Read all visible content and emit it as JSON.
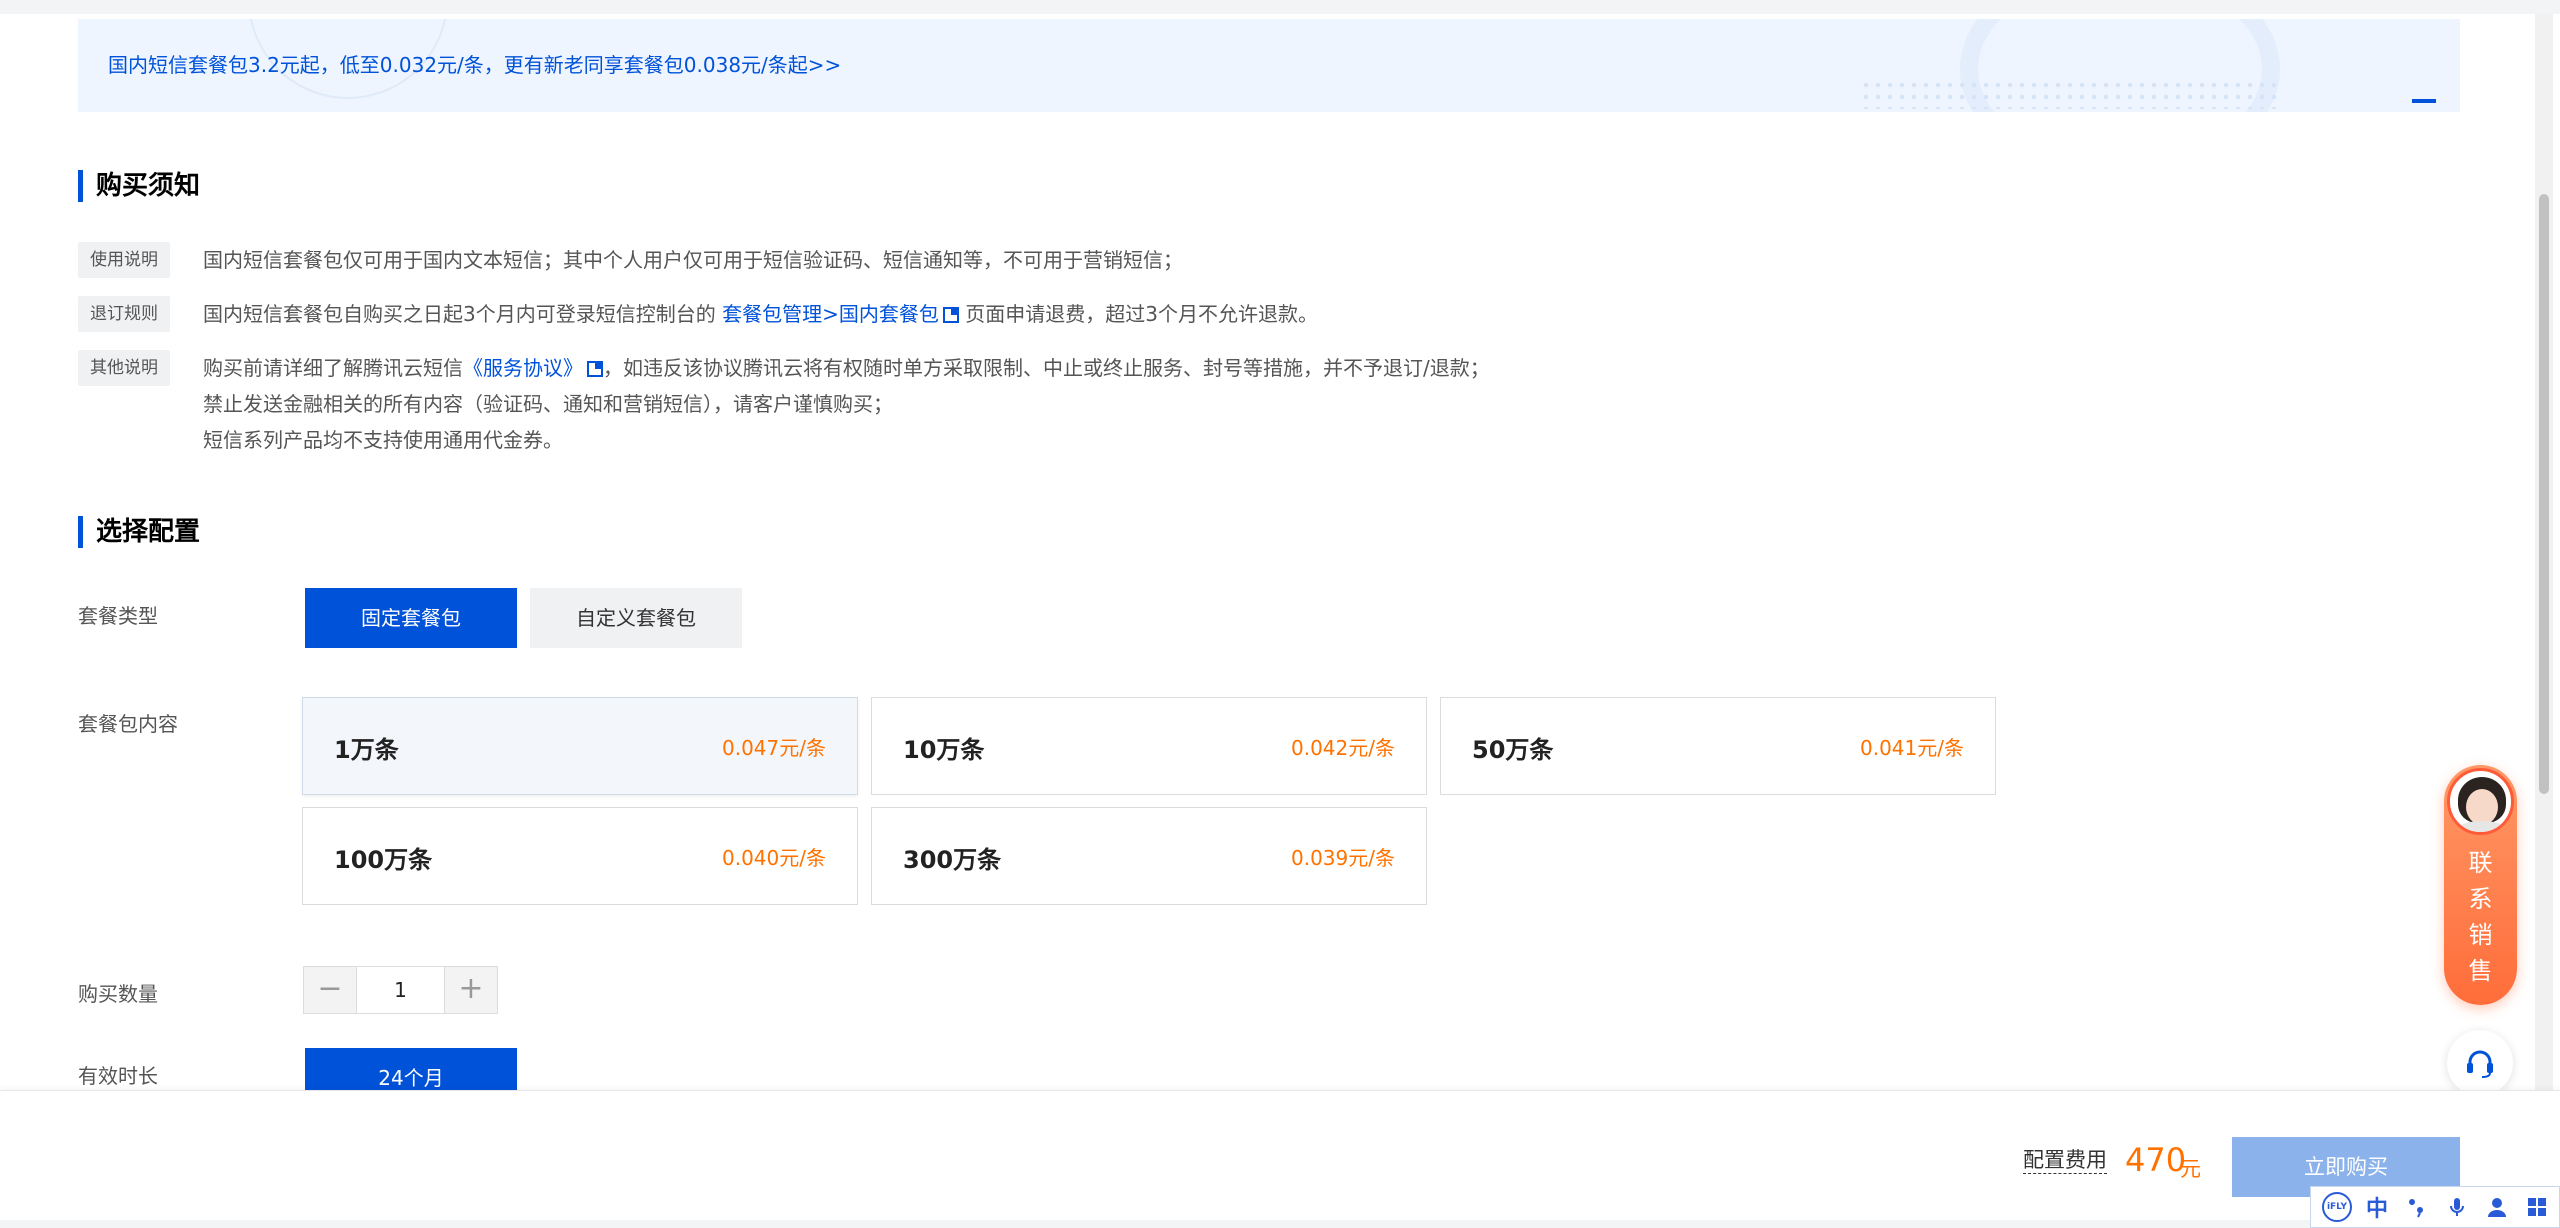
{
  "banner": {
    "text": "国内短信套餐包3.2元起，低至0.032元/条，更有新老同享套餐包0.038元/条起>>"
  },
  "notice": {
    "title": "购买须知",
    "usage": {
      "tag": "使用说明",
      "text": "国内短信套餐包仅可用于国内文本短信；其中个人用户仅可用于短信验证码、短信通知等，不可用于营销短信；"
    },
    "refund": {
      "tag": "退订规则",
      "before": "国内短信套餐包自购买之日起3个月内可登录短信控制台的",
      "link": "套餐包管理>国内套餐包",
      "after": "页面申请退费，超过3个月不允许退款。"
    },
    "other": {
      "tag": "其他说明",
      "line1_before": "购买前请详细了解腾讯云短信",
      "line1_link": "《服务协议》",
      "line1_after": "，如违反该协议腾讯云将有权随时单方采取限制、中止或终止服务、封号等措施，并不予退订/退款；",
      "line2": "禁止发送金融相关的所有内容（验证码、通知和营销短信），请客户谨慎购买；",
      "line3": "短信系列产品均不支持使用通用代金券。"
    }
  },
  "config": {
    "title": "选择配置",
    "type_label": "套餐类型",
    "types": [
      "固定套餐包",
      "自定义套餐包"
    ],
    "content_label": "套餐包内容",
    "packages": [
      {
        "name": "1万条",
        "price": "0.047元/条",
        "selected": true
      },
      {
        "name": "10万条",
        "price": "0.042元/条"
      },
      {
        "name": "50万条",
        "price": "0.041元/条"
      },
      {
        "name": "100万条",
        "price": "0.040元/条"
      },
      {
        "name": "300万条",
        "price": "0.039元/条"
      }
    ],
    "quantity_label": "购买数量",
    "quantity": "1",
    "minus": "−",
    "plus": "+",
    "duration_label": "有效时长",
    "duration": "24个月"
  },
  "sales": {
    "chars": [
      "联",
      "系",
      "销",
      "售"
    ]
  },
  "footer": {
    "fee_label": "配置费用",
    "fee_value": "470",
    "fee_unit": "元",
    "buy": "立即购买"
  },
  "ime": {
    "logo": "iFLY",
    "lang": "中"
  },
  "colors": {
    "primary": "#0052d9",
    "price": "#ff7200",
    "sales_widget": "#ff7a45"
  }
}
